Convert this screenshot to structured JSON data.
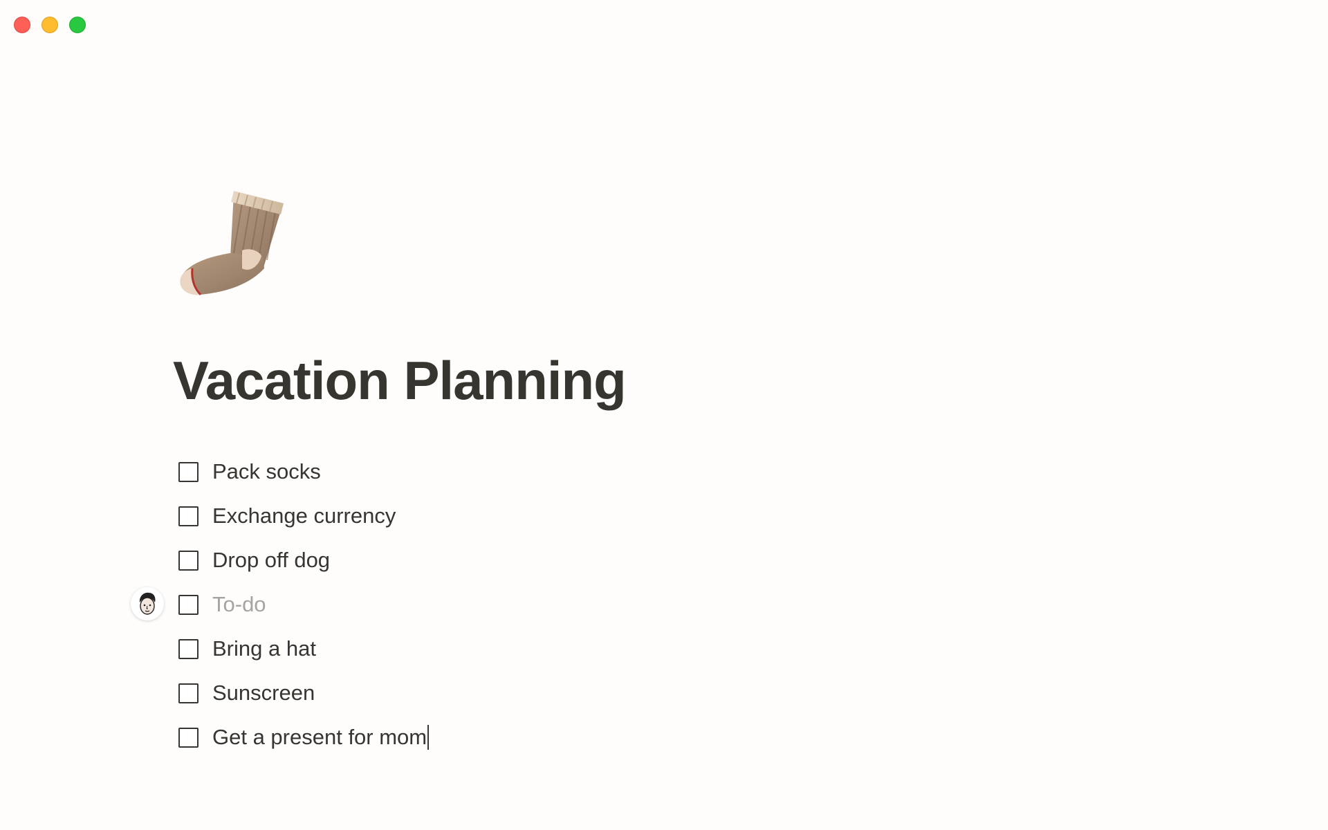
{
  "window": {
    "controls": [
      "close",
      "minimize",
      "zoom"
    ]
  },
  "page": {
    "icon": "sock-emoji-icon",
    "title": "Vacation Planning"
  },
  "todos": [
    {
      "text": "Pack socks",
      "checked": false
    },
    {
      "text": "Exchange currency",
      "checked": false
    },
    {
      "text": "Drop off dog",
      "checked": false
    },
    {
      "text": "To-do",
      "checked": false,
      "placeholder": true
    },
    {
      "text": "Bring a hat",
      "checked": false
    },
    {
      "text": "Sunscreen",
      "checked": false
    },
    {
      "text": "Get a present for mom",
      "checked": false
    }
  ],
  "colors": {
    "text": "#37352f",
    "placeholder": "#a5a4a1",
    "background": "#fefdfc",
    "close": "#fe5f57",
    "minimize": "#febc2e",
    "zoom": "#28c840"
  }
}
